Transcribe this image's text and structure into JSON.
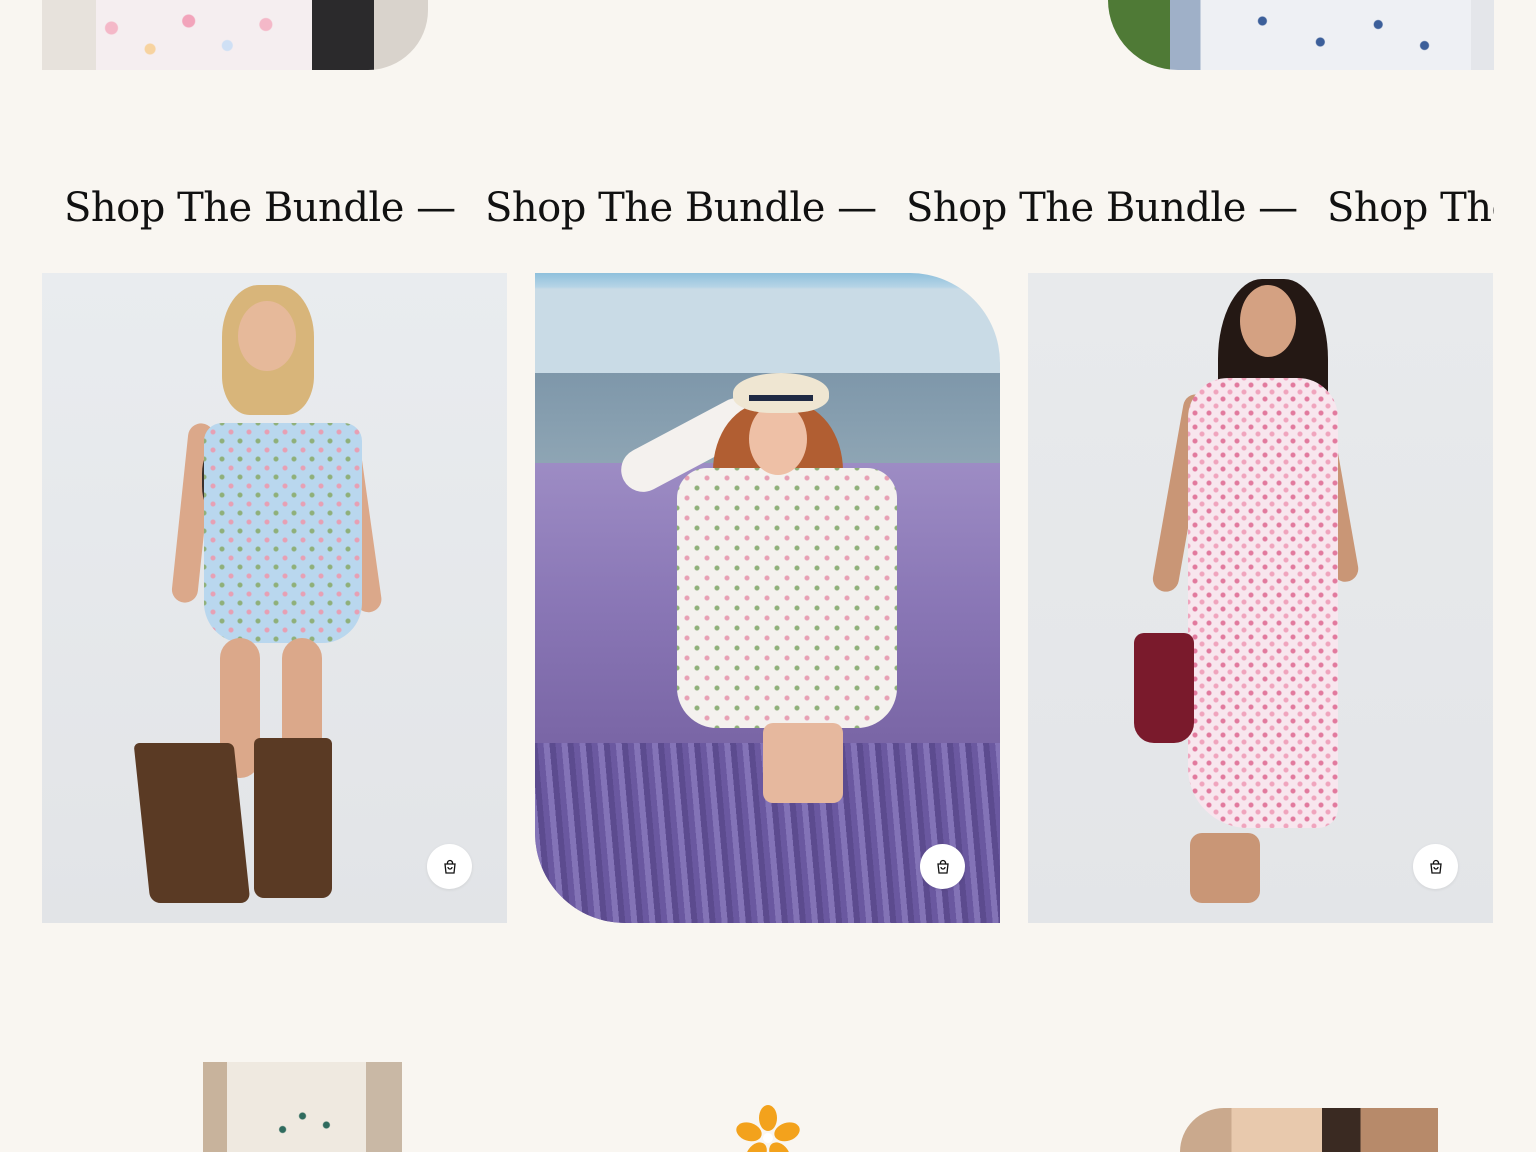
{
  "marquee": {
    "items": [
      "Shop The Bundle —",
      "Shop The Bundle —",
      "Shop The Bundle —",
      "Shop The Bundle —"
    ]
  },
  "products": [
    {
      "photo_icon": "floral-strapless-mini-dress-photo",
      "cart_icon": "shopping-bag-icon"
    },
    {
      "photo_icon": "lavender-field-white-dress-photo",
      "cart_icon": "shopping-bag-icon"
    },
    {
      "photo_icon": "pink-floral-maxi-dress-photo",
      "cart_icon": "shopping-bag-icon"
    }
  ],
  "colors": {
    "background": "#f9f6f1",
    "text": "#111111",
    "flower": "#f3a21c"
  }
}
